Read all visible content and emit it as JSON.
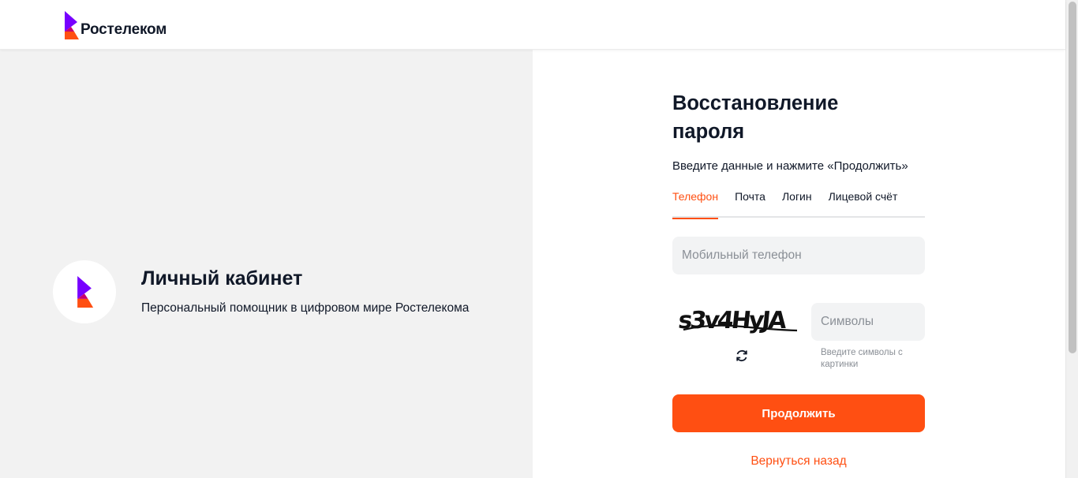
{
  "header": {
    "brand": "Ростелеком"
  },
  "promo": {
    "title": "Личный кабинет",
    "subtitle": "Персональный помощник в цифровом мире Ростелекома"
  },
  "form": {
    "title": "Восстановление пароля",
    "subtitle": "Введите данные и нажмите «Продолжить»",
    "tabs": [
      {
        "label": "Телефон",
        "active": true
      },
      {
        "label": "Почта",
        "active": false
      },
      {
        "label": "Логин",
        "active": false
      },
      {
        "label": "Лицевой счёт",
        "active": false
      }
    ],
    "phone": {
      "placeholder": "Мобильный телефон",
      "value": ""
    },
    "captcha": {
      "image_text": "s3v4HyJA",
      "refresh_icon": "refresh-icon",
      "input_placeholder": "Символы",
      "hint": "Введите символы с картинки"
    },
    "continue_label": "Продолжить",
    "back_label": "Вернуться назад"
  },
  "colors": {
    "accent": "#ff4f12",
    "brand_purple": "#7700ff",
    "panel_bg": "#f2f2f2",
    "input_bg": "#f2f3f4",
    "text": "#101828"
  }
}
